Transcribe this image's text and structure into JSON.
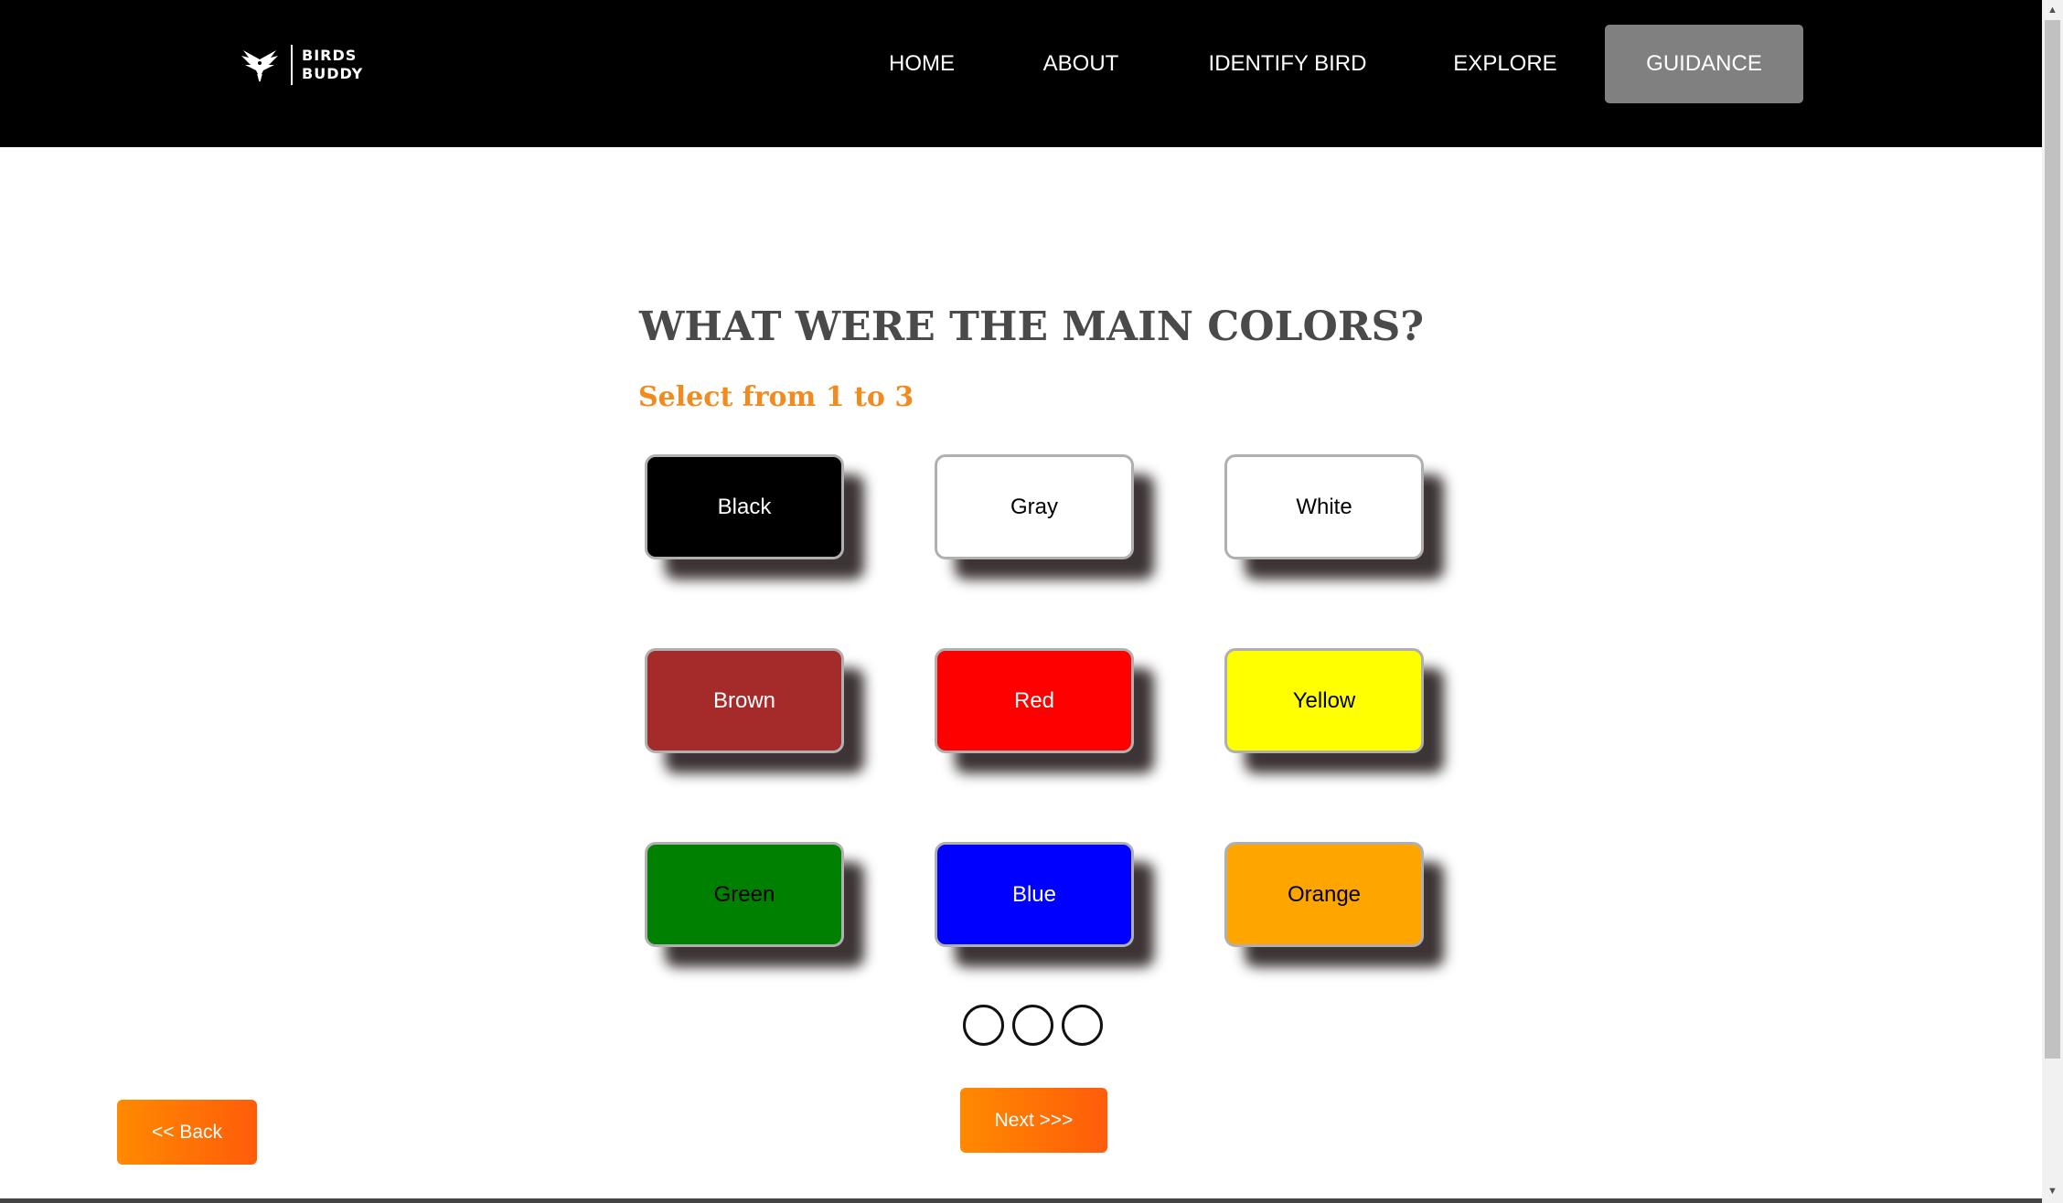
{
  "header": {
    "logo": {
      "line1": "BIRDS",
      "line2": "BUDDY",
      "icon": "bird-logo-icon"
    },
    "nav": [
      {
        "label": "HOME",
        "active": false
      },
      {
        "label": "ABOUT",
        "active": false
      },
      {
        "label": "IDENTIFY BIRD",
        "active": false
      },
      {
        "label": "EXPLORE",
        "active": false
      },
      {
        "label": "GUIDANCE",
        "active": true
      }
    ]
  },
  "main": {
    "question": "WHAT WERE THE MAIN COLORS?",
    "instruction": "Select from 1 to 3",
    "colors": [
      {
        "label": "Black",
        "bg": "#000000",
        "fg": "#ffffff"
      },
      {
        "label": "Gray",
        "bg": "#ffffff",
        "fg": "#000000"
      },
      {
        "label": "White",
        "bg": "#ffffff",
        "fg": "#000000"
      },
      {
        "label": "Brown",
        "bg": "#a52a2a",
        "fg": "#ffffff"
      },
      {
        "label": "Red",
        "bg": "#ff0000",
        "fg": "#ffffff"
      },
      {
        "label": "Yellow",
        "bg": "#ffff00",
        "fg": "#000000"
      },
      {
        "label": "Green",
        "bg": "#008000",
        "fg": "#000000"
      },
      {
        "label": "Blue",
        "bg": "#0000ff",
        "fg": "#ffffff"
      },
      {
        "label": "Orange",
        "bg": "#ffa500",
        "fg": "#000000"
      }
    ],
    "selected_count": 0,
    "max_selection": 3
  },
  "footer": {
    "back_label": "<< Back",
    "next_label": "Next  >>>"
  },
  "theme": {
    "accent": "#f28b1f",
    "nav_bg": "#000000",
    "active_nav_bg": "#808080"
  }
}
